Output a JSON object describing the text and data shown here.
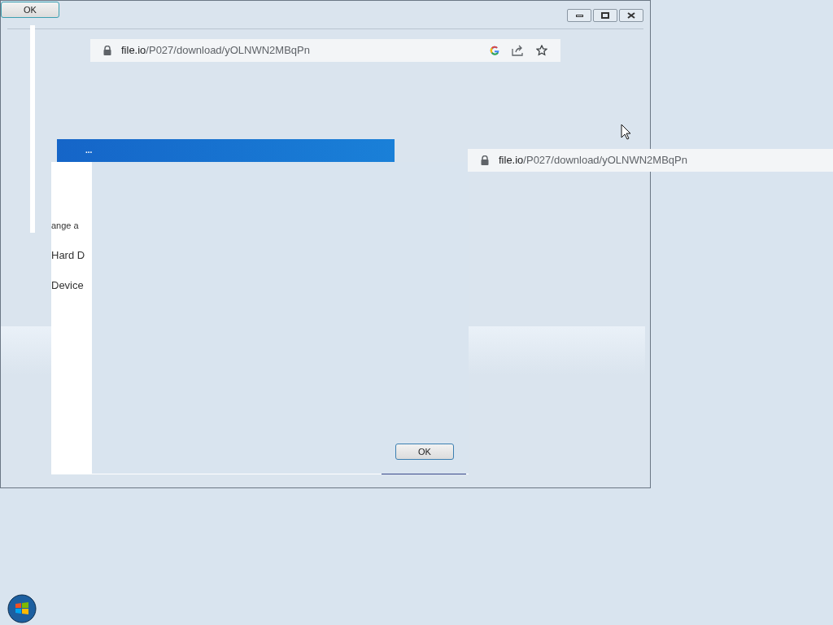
{
  "top_button": {
    "label": "OK"
  },
  "address_bars": [
    {
      "url": "file.io/P027/download/yOLNWN2MBqPn",
      "toolbar": true
    },
    {
      "url": "file.io/P027/download/yOLNWN2MBqPn",
      "toolbar": false
    }
  ],
  "dialog": {
    "title": "...",
    "fragments": [
      "ange a",
      "Hard D",
      "Device"
    ],
    "button": "OK"
  }
}
